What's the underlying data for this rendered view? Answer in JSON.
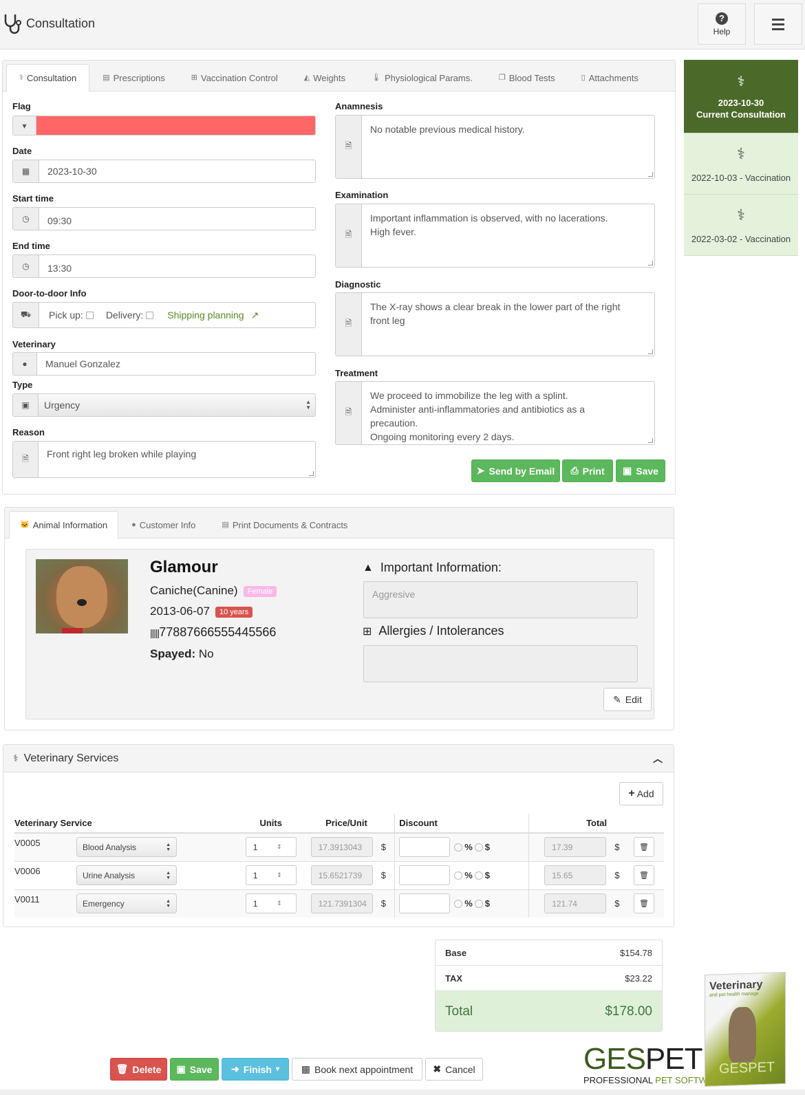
{
  "header": {
    "title": "Consultation",
    "help_label": "Help"
  },
  "consult_tabs": [
    {
      "label": "Consultation",
      "icon": "stethoscope-icon"
    },
    {
      "label": "Prescriptions",
      "icon": "newspaper-icon"
    },
    {
      "label": "Vaccination Control",
      "icon": "medkit-icon"
    },
    {
      "label": "Weights",
      "icon": "area-chart-icon"
    },
    {
      "label": "Physiological Params.",
      "icon": "thermometer-icon"
    },
    {
      "label": "Blood Tests",
      "icon": "files-icon"
    },
    {
      "label": "Attachments",
      "icon": "file-icon"
    }
  ],
  "form": {
    "flag_label": "Flag",
    "flag_color": "#ff6666",
    "date_label": "Date",
    "date_value": "2023-10-30",
    "start_label": "Start time",
    "start_value": "09:30",
    "end_label": "End time",
    "end_value": "13:30",
    "door_label": "Door-to-door Info",
    "pickup_label": "Pick up:",
    "delivery_label": "Delivery:",
    "shipping_link": "Shipping planning",
    "vet_label": "Veterinary",
    "vet_value": "Manuel Gonzalez",
    "type_label": "Type",
    "type_value": "Urgency",
    "reason_label": "Reason",
    "reason_value": "Front right leg broken while playing",
    "anamnesis_label": "Anamnesis",
    "anamnesis_value": "No notable previous medical history.",
    "exam_label": "Examination",
    "exam_value": "Important inflammation is observed, with no lacerations.\nHigh fever.",
    "diag_label": "Diagnostic",
    "diag_value": "The X-ray shows a clear break in the lower part of the right\nfront leg",
    "treat_label": "Treatment",
    "treat_value": "We proceed to immobilize the leg with a splint.\nAdminister anti-inflammatories and antibiotics as a\nprecaution.\nOngoing monitoring every 2 days.",
    "send_email": "Send by Email",
    "print": "Print",
    "save": "Save"
  },
  "history": [
    {
      "date": "2023-10-30",
      "label": "Current Consultation",
      "current": true
    },
    {
      "label": "2022-10-03 - Vaccination"
    },
    {
      "label": "2022-03-02 - Vaccination"
    }
  ],
  "animal_tabs": [
    {
      "label": "Animal Information"
    },
    {
      "label": "Customer Info"
    },
    {
      "label": "Print Documents & Contracts"
    }
  ],
  "animal": {
    "name": "Glamour",
    "breed": "Caniche(Canine)",
    "sex": "Female",
    "sex_color": "#f9b8e8",
    "birth": "2013-06-07",
    "age": "10 years",
    "age_color": "#d9534f",
    "chip": "77887666555445566",
    "spayed_label": "Spayed:",
    "spayed_value": "No",
    "important_label": "Important Information:",
    "important_value": "Aggresive",
    "allergies_label": "Allergies / Intolerances",
    "allergies_value": "",
    "edit": "Edit"
  },
  "services": {
    "title": "Veterinary Services",
    "add": "Add",
    "columns": [
      "Veterinary Service",
      "Units",
      "Price/Unit",
      "Discount",
      "Total"
    ],
    "currency": "$",
    "rows": [
      {
        "code": "V0005",
        "service": "Blood Analysis",
        "units": "1",
        "price": "17.3913043",
        "discount": "",
        "total": "17.39"
      },
      {
        "code": "V0006",
        "service": "Urine Analysis",
        "units": "1",
        "price": "15.6521739",
        "discount": "",
        "total": "15.65"
      },
      {
        "code": "V0011",
        "service": "Emergency",
        "units": "1",
        "price": "121.7391304",
        "discount": "",
        "total": "121.74"
      }
    ]
  },
  "totals": {
    "base_label": "Base",
    "base_value": "$154.78",
    "tax_label": "TAX",
    "tax_value": "$23.22",
    "total_label": "Total",
    "total_value": "$178.00"
  },
  "footer": {
    "delete": "Delete",
    "save": "Save",
    "finish": "Finish",
    "book": "Book next appointment",
    "cancel": "Cancel"
  },
  "brand": {
    "logo_part1": "GES",
    "logo_part2": "PET",
    "tagline1": "PROFESSIONAL ",
    "tagline2": "PET SOFTWARE",
    "box_title": "Veterinary",
    "box_subtitle": "and pet health manage",
    "box_brand": "GESPET"
  }
}
